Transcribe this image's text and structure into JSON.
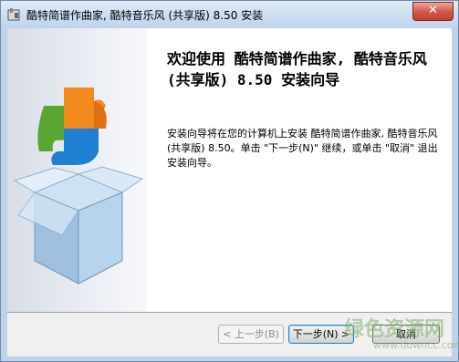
{
  "window": {
    "title": "酷特简谱作曲家, 酷特音乐风 (共享版) 8.50 安装",
    "close_icon": "close-icon"
  },
  "art": {
    "icon": "puzzle-box-illustration"
  },
  "content": {
    "heading": "欢迎使用 酷特简谱作曲家, 酷特音乐风 (共享版) 8.50 安装向导",
    "body": "安装向导将在您的计算机上安装 酷特简谱作曲家, 酷特音乐风 (共享版) 8.50。单击 \"下一步(N)\" 继续，或单击 \"取消\" 退出安装向导。"
  },
  "buttons": {
    "back": "< 上一步(B)",
    "next": "下一步(N) >",
    "cancel": "取消"
  },
  "watermark": {
    "text": "绿色资源网",
    "url": "www.downcc.com"
  }
}
